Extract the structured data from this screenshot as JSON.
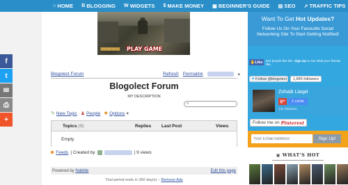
{
  "nav": {
    "items": [
      {
        "icon": "⌂",
        "label": "HOME"
      },
      {
        "icon": "B",
        "label": "BLOGGING"
      },
      {
        "icon": "W",
        "label": "WIDGETS"
      },
      {
        "icon": "$",
        "label": "MAKE MONEY"
      },
      {
        "icon": "▦",
        "label": "BEGINNER'S GUIDE"
      },
      {
        "icon": "▤",
        "label": "SEO"
      },
      {
        "icon": "↗",
        "label": "TRAFFIC TIPS"
      }
    ]
  },
  "social_bar": {
    "facebook": "f",
    "twitter": "t",
    "mail": "✉",
    "print": "⎙",
    "more": "+"
  },
  "game_banner": {
    "cta": "PLAY GAME",
    "bullets": "▮▮▮▮▮▮▮▮▮▮▮▮"
  },
  "forum": {
    "breadcrumb": "Blogolect Forum",
    "refresh": "Refresh",
    "permalink": "Permalink",
    "title": "Blogolect Forum",
    "description": "MY DESCRIPTION",
    "search_placeholder": "",
    "new_topic": "New Topic",
    "people": "People",
    "options": "Options",
    "table": {
      "col_topics": "Topics",
      "col_topics_count": "(0)",
      "col_replies": "Replies",
      "col_last_post": "Last Post",
      "col_views": "Views",
      "empty_text": "Empty"
    },
    "feeds": "Feeds",
    "created_by": "| Created by",
    "views_count": "| 9 views",
    "powered_by": "Powered by",
    "nabble": "Nabble",
    "edit_page": "Edit this page",
    "trial_text": "Trial period ends in 360 day(s) –",
    "remove_ads": "Remove Ads"
  },
  "sidebar": {
    "promo": {
      "heading_prefix": "Want To Get",
      "heading_bold": "Hot Updates?",
      "description": "Follow Us On Your Favourite Social Networking Site To Start Getting Notified!"
    },
    "facebook": {
      "like_label": "Like",
      "text_prefix": "522 people like this.",
      "sign_up": "Sign Up",
      "text_suffix": "to see what your friends like."
    },
    "twitter": {
      "follow_label": "Follow @blogolect",
      "followers": "1,845 followers"
    },
    "google_plus": {
      "name": "Zohaib Liaqat",
      "g_label": "g+",
      "circle_label": "1 circle",
      "followers": "131 followers"
    },
    "pinterest": {
      "label": "Follow me on",
      "brand": "Pinterest"
    },
    "subscribe": {
      "placeholder": "Your Email Address",
      "button": "Sign Up!"
    },
    "whats_hot": {
      "title": "WHAT'S HOT",
      "thumb_colors": [
        "#5a7a3a",
        "#3a6a8a",
        "#7a4a3a",
        "#8aa0b0",
        "#b08a60",
        "#4a5a70",
        "#6a8a5a",
        "#9a7a5a"
      ]
    }
  }
}
